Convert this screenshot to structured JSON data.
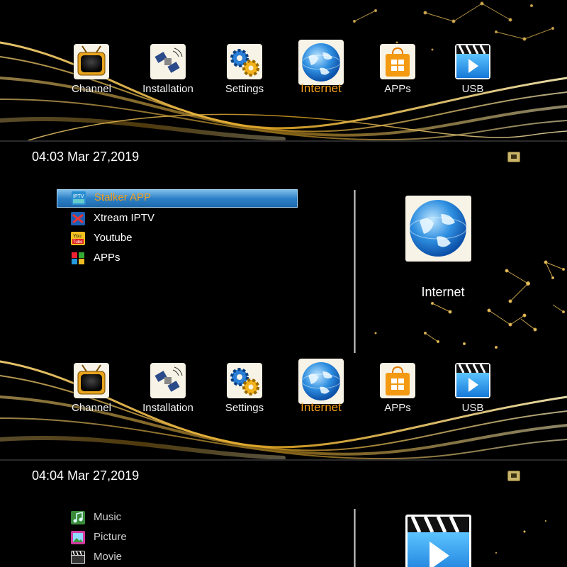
{
  "nav": {
    "items": [
      {
        "label": "Channel",
        "icon": "tv-icon"
      },
      {
        "label": "Installation",
        "icon": "satellite-icon"
      },
      {
        "label": "Settings",
        "icon": "gears-icon"
      },
      {
        "label": "Internet",
        "icon": "globe-icon",
        "selected": true
      },
      {
        "label": "APPs",
        "icon": "apps-bag-icon"
      },
      {
        "label": "USB",
        "icon": "clapper-play-icon"
      }
    ]
  },
  "screen_internet": {
    "clock": "04:03 Mar 27,2019",
    "items": [
      {
        "label": "Stalker APP",
        "icon": "iptv-icon",
        "selected": true
      },
      {
        "label": "Xtream IPTV",
        "icon": "xtream-icon"
      },
      {
        "label": "Youtube",
        "icon": "youtube-icon"
      },
      {
        "label": "APPs",
        "icon": "apps-grid-icon"
      }
    ],
    "preview_label": "Internet"
  },
  "screen_usb": {
    "clock": "04:04 Mar 27,2019",
    "items": [
      {
        "label": "Music",
        "icon": "music-icon"
      },
      {
        "label": "Picture",
        "icon": "picture-icon"
      },
      {
        "label": "Movie",
        "icon": "movie-icon"
      }
    ]
  },
  "colors": {
    "accent_orange": "#f5a01a",
    "selection_blue": "#2d80c6",
    "gold_wave": "#e8b53a",
    "background": "#000000"
  }
}
